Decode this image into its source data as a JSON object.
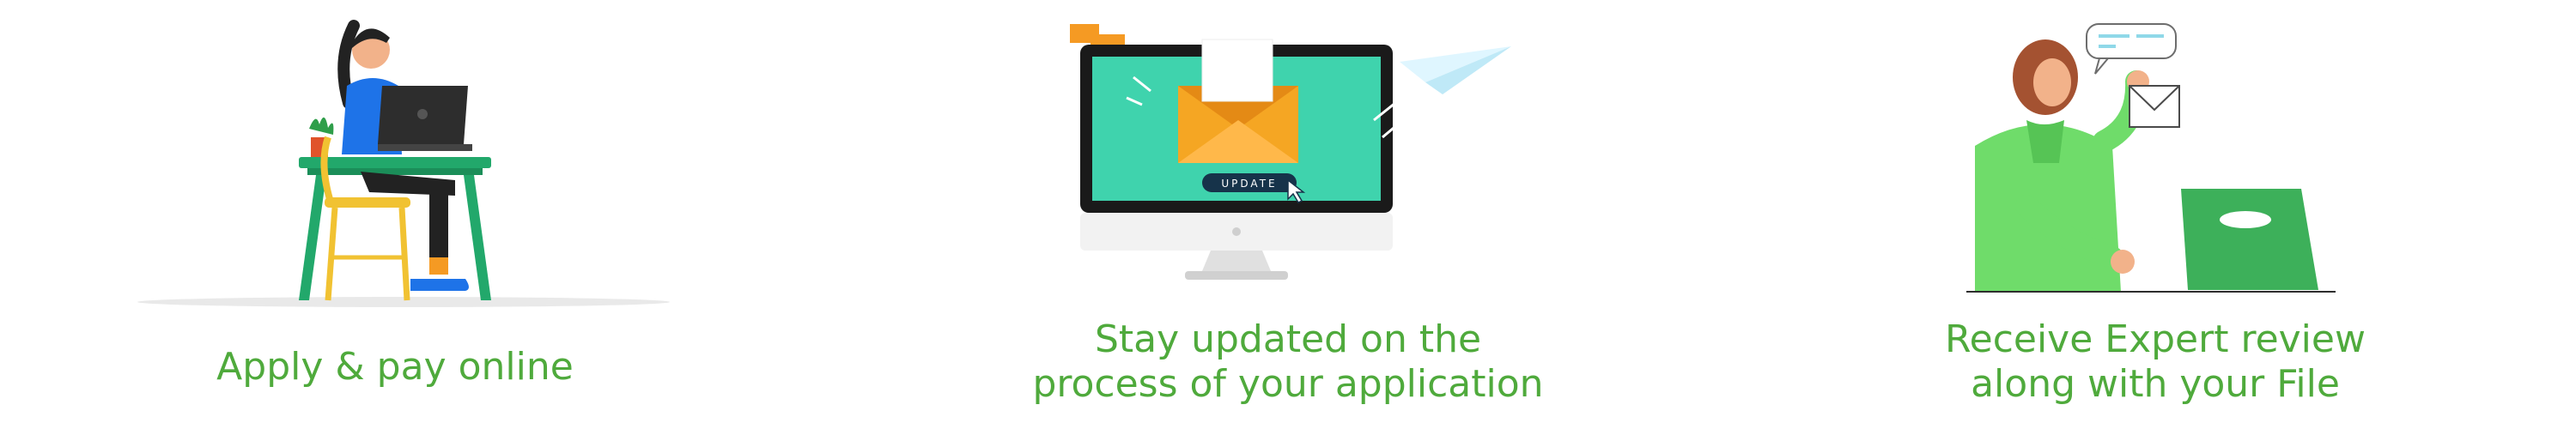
{
  "steps": [
    {
      "id": "apply",
      "illustration": "woman-working-on-laptop",
      "caption_lines": [
        "Apply & pay online"
      ]
    },
    {
      "id": "updates",
      "illustration": "monitor-with-envelope",
      "badge": "UPDATE",
      "caption_lines": [
        "Stay updated on the",
        "process of your application"
      ]
    },
    {
      "id": "review",
      "illustration": "woman-reviewing-mail",
      "caption_lines": [
        "Receive Expert review",
        "along with your File"
      ]
    }
  ],
  "colors": {
    "caption": "#4faa3c",
    "desk": "#22a86b",
    "screen": "#3fd3ad",
    "envelope": "#f5a623",
    "shirt_blue": "#1e73e8",
    "shirt_green": "#6fdc6a"
  }
}
